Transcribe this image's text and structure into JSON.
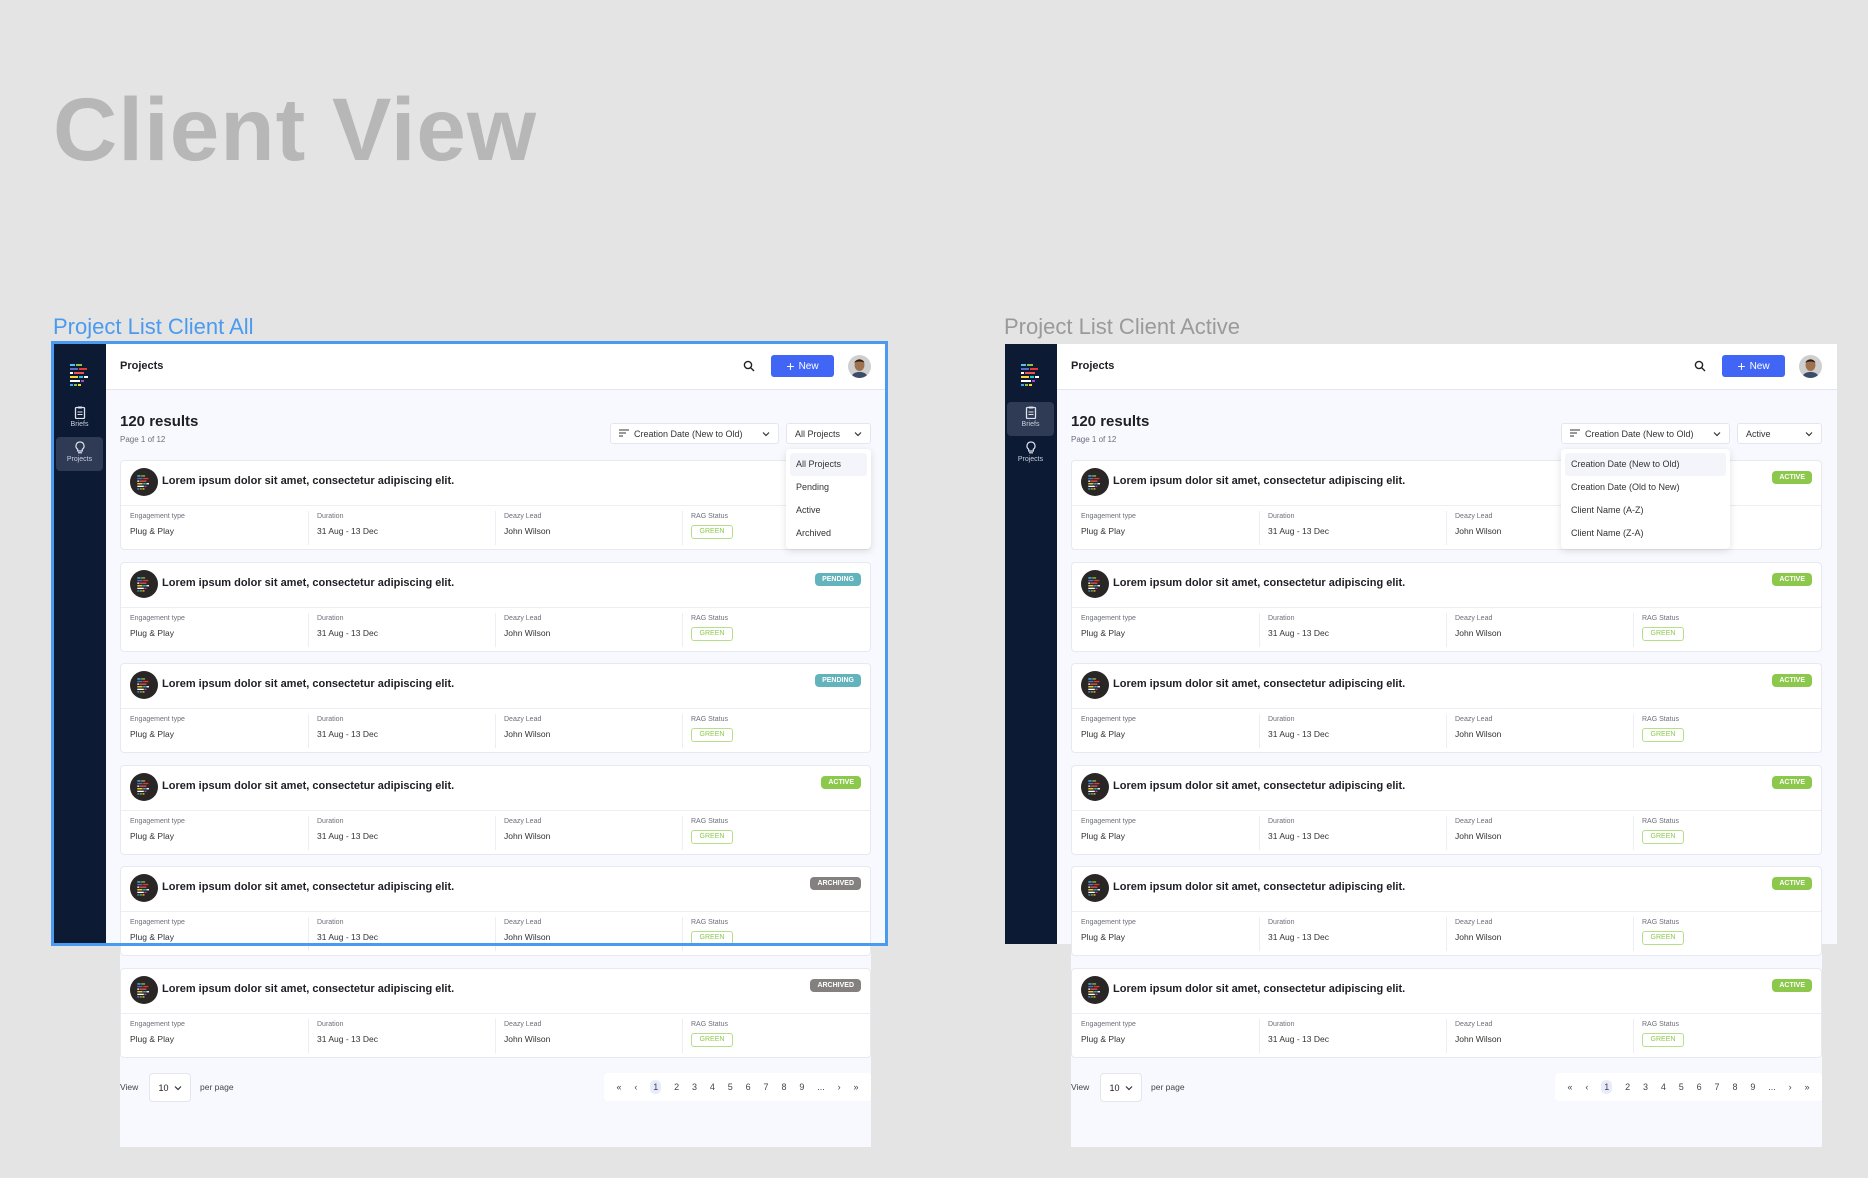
{
  "page_title": "Client View",
  "colors": {
    "accent": "#4166f5",
    "sidebar": "#0d1a33",
    "pending": "#63b3bd",
    "active": "#8cc84b",
    "archived": "#858080",
    "rag_green": "#8cc84b",
    "frame_selected": "#4a9bf0"
  },
  "views": [
    {
      "label": "Project List Client All",
      "selected": true,
      "sidebar": {
        "items": [
          {
            "label": "Briefs",
            "icon": "clipboard-icon",
            "active": false
          },
          {
            "label": "Projects",
            "icon": "lightbulb-icon",
            "active": true
          }
        ]
      },
      "header": {
        "title": "Projects",
        "new_label": "New"
      },
      "results": "120 results",
      "page_of": "Page 1 of 12",
      "sort": {
        "value": "Creation Date (New to Old)"
      },
      "filter": {
        "value": "All Projects"
      },
      "open_menu": {
        "for": "filter",
        "options": [
          "All Projects",
          "Pending",
          "Active",
          "Archived"
        ],
        "selected": 0
      },
      "cards": [
        {
          "title": "Lorem ipsum dolor sit amet, consectetur adipiscing elit.",
          "status": "",
          "engagement": "Plug & Play",
          "duration": "31 Aug - 13 Dec",
          "lead": "John Wilson",
          "rag": "GREEN"
        },
        {
          "title": "Lorem ipsum dolor sit amet, consectetur adipiscing elit.",
          "status": "PENDING",
          "engagement": "Plug & Play",
          "duration": "31 Aug - 13 Dec",
          "lead": "John Wilson",
          "rag": "GREEN"
        },
        {
          "title": "Lorem ipsum dolor sit amet, consectetur adipiscing elit.",
          "status": "PENDING",
          "engagement": "Plug & Play",
          "duration": "31 Aug - 13 Dec",
          "lead": "John Wilson",
          "rag": "GREEN"
        },
        {
          "title": "Lorem ipsum dolor sit amet, consectetur adipiscing elit.",
          "status": "ACTIVE",
          "engagement": "Plug & Play",
          "duration": "31 Aug - 13 Dec",
          "lead": "John Wilson",
          "rag": "GREEN"
        },
        {
          "title": "Lorem ipsum dolor sit amet, consectetur adipiscing elit.",
          "status": "ARCHIVED",
          "engagement": "Plug & Play",
          "duration": "31 Aug - 13 Dec",
          "lead": "John Wilson",
          "rag": "GREEN"
        },
        {
          "title": "Lorem ipsum dolor sit amet, consectetur adipiscing elit.",
          "status": "ARCHIVED",
          "engagement": "Plug & Play",
          "duration": "31 Aug - 13 Dec",
          "lead": "John Wilson",
          "rag": "GREEN"
        }
      ],
      "field_labels": {
        "engagement": "Engagement type",
        "duration": "Duration",
        "lead": "Deazy Lead",
        "rag": "RAG Status"
      },
      "pagination": {
        "view": "View",
        "per_page_value": "10",
        "per_page": "per page",
        "pages": [
          "«",
          "‹",
          "1",
          "2",
          "3",
          "4",
          "5",
          "6",
          "7",
          "8",
          "9",
          "...",
          "›",
          "»"
        ],
        "current": "1"
      }
    },
    {
      "label": "Project List Client Active",
      "selected": false,
      "sidebar": {
        "items": [
          {
            "label": "Briefs",
            "icon": "clipboard-icon",
            "active": true
          },
          {
            "label": "Projects",
            "icon": "lightbulb-icon",
            "active": false
          }
        ]
      },
      "header": {
        "title": "Projects",
        "new_label": "New"
      },
      "results": "120 results",
      "page_of": "Page 1 of 12",
      "sort": {
        "value": "Creation Date (New to Old)"
      },
      "filter": {
        "value": "Active"
      },
      "open_menu": {
        "for": "sort",
        "options": [
          "Creation Date (New to Old)",
          "Creation Date (Old to New)",
          "Client Name (A-Z)",
          "Client Name (Z-A)"
        ],
        "selected": 0
      },
      "cards": [
        {
          "title": "Lorem ipsum dolor sit amet, consectetur adipiscing elit.",
          "status": "ACTIVE",
          "engagement": "Plug & Play",
          "duration": "31 Aug - 13 Dec",
          "lead": "John Wilson",
          "rag": "GREEN"
        },
        {
          "title": "Lorem ipsum dolor sit amet, consectetur adipiscing elit.",
          "status": "ACTIVE",
          "engagement": "Plug & Play",
          "duration": "31 Aug - 13 Dec",
          "lead": "John Wilson",
          "rag": "GREEN"
        },
        {
          "title": "Lorem ipsum dolor sit amet, consectetur adipiscing elit.",
          "status": "ACTIVE",
          "engagement": "Plug & Play",
          "duration": "31 Aug - 13 Dec",
          "lead": "John Wilson",
          "rag": "GREEN"
        },
        {
          "title": "Lorem ipsum dolor sit amet, consectetur adipiscing elit.",
          "status": "ACTIVE",
          "engagement": "Plug & Play",
          "duration": "31 Aug - 13 Dec",
          "lead": "John Wilson",
          "rag": "GREEN"
        },
        {
          "title": "Lorem ipsum dolor sit amet, consectetur adipiscing elit.",
          "status": "ACTIVE",
          "engagement": "Plug & Play",
          "duration": "31 Aug - 13 Dec",
          "lead": "John Wilson",
          "rag": "GREEN"
        },
        {
          "title": "Lorem ipsum dolor sit amet, consectetur adipiscing elit.",
          "status": "ACTIVE",
          "engagement": "Plug & Play",
          "duration": "31 Aug - 13 Dec",
          "lead": "John Wilson",
          "rag": "GREEN"
        }
      ],
      "field_labels": {
        "engagement": "Engagement type",
        "duration": "Duration",
        "lead": "Deazy Lead",
        "rag": "RAG Status"
      },
      "pagination": {
        "view": "View",
        "per_page_value": "10",
        "per_page": "per page",
        "pages": [
          "«",
          "‹",
          "1",
          "2",
          "3",
          "4",
          "5",
          "6",
          "7",
          "8",
          "9",
          "...",
          "›",
          "»"
        ],
        "current": "1"
      }
    }
  ]
}
